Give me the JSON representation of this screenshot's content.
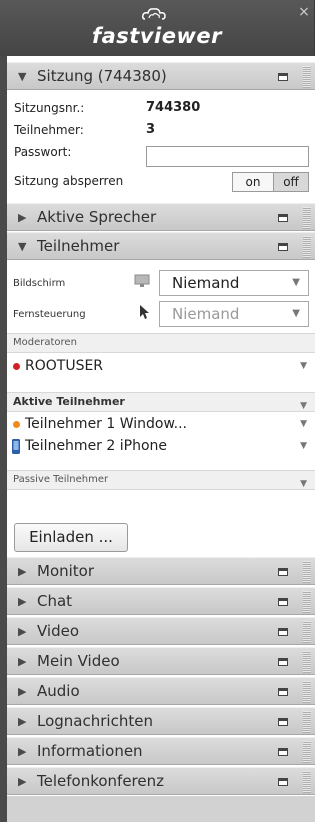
{
  "app": {
    "logo_text": "fastviewer",
    "close_glyph": "×",
    "logo_icon": "cloud-logo-icon"
  },
  "session_panel": {
    "header": "Sitzung (744380)",
    "rows": [
      {
        "label": "Sitzungsnr.:",
        "value": "744380"
      },
      {
        "label": "Teilnehmer:",
        "value": "3"
      },
      {
        "label": "Passwort:",
        "value": ""
      }
    ],
    "lock_label": "Sitzung absperren",
    "toggle_on": "on",
    "toggle_off": "off",
    "toggle_state": "off"
  },
  "sections": {
    "aktive_sprecher": "Aktive Sprecher",
    "teilnehmer": "Teilnehmer",
    "monitor": "Monitor",
    "chat": "Chat",
    "video": "Video",
    "mein_video": "Mein Video",
    "audio": "Audio",
    "lognachrichten": "Lognachrichten",
    "informationen": "Informationen",
    "telefonkonferenz": "Telefonkonferenz"
  },
  "participants": {
    "bildschirm_label": "Bildschirm",
    "bildschirm_value": "Niemand",
    "fernsteuerung_label": "Fernsteuerung",
    "fernsteuerung_value": "Niemand",
    "moderatoren_label": "Moderatoren",
    "moderators": [
      {
        "name": "ROOTUSER",
        "color": "#d0202a"
      }
    ],
    "aktive_label": "Aktive Teilnehmer",
    "active": [
      {
        "name": "Teilnehmer 1 Window...",
        "color": "#f08a1c",
        "icon": "dot"
      },
      {
        "name": "Teilnehmer 2 iPhone",
        "color": "#3a78c8",
        "icon": "phone-icon"
      }
    ],
    "passive_label": "Passive Teilnehmer",
    "invite_button": "Einladen ..."
  },
  "colors": {
    "titlebar": "#4e4e4e",
    "section_header": "#d2d2d2",
    "moderator": "#d0202a",
    "participant_1": "#f08a1c",
    "participant_2": "#3a78c8"
  }
}
